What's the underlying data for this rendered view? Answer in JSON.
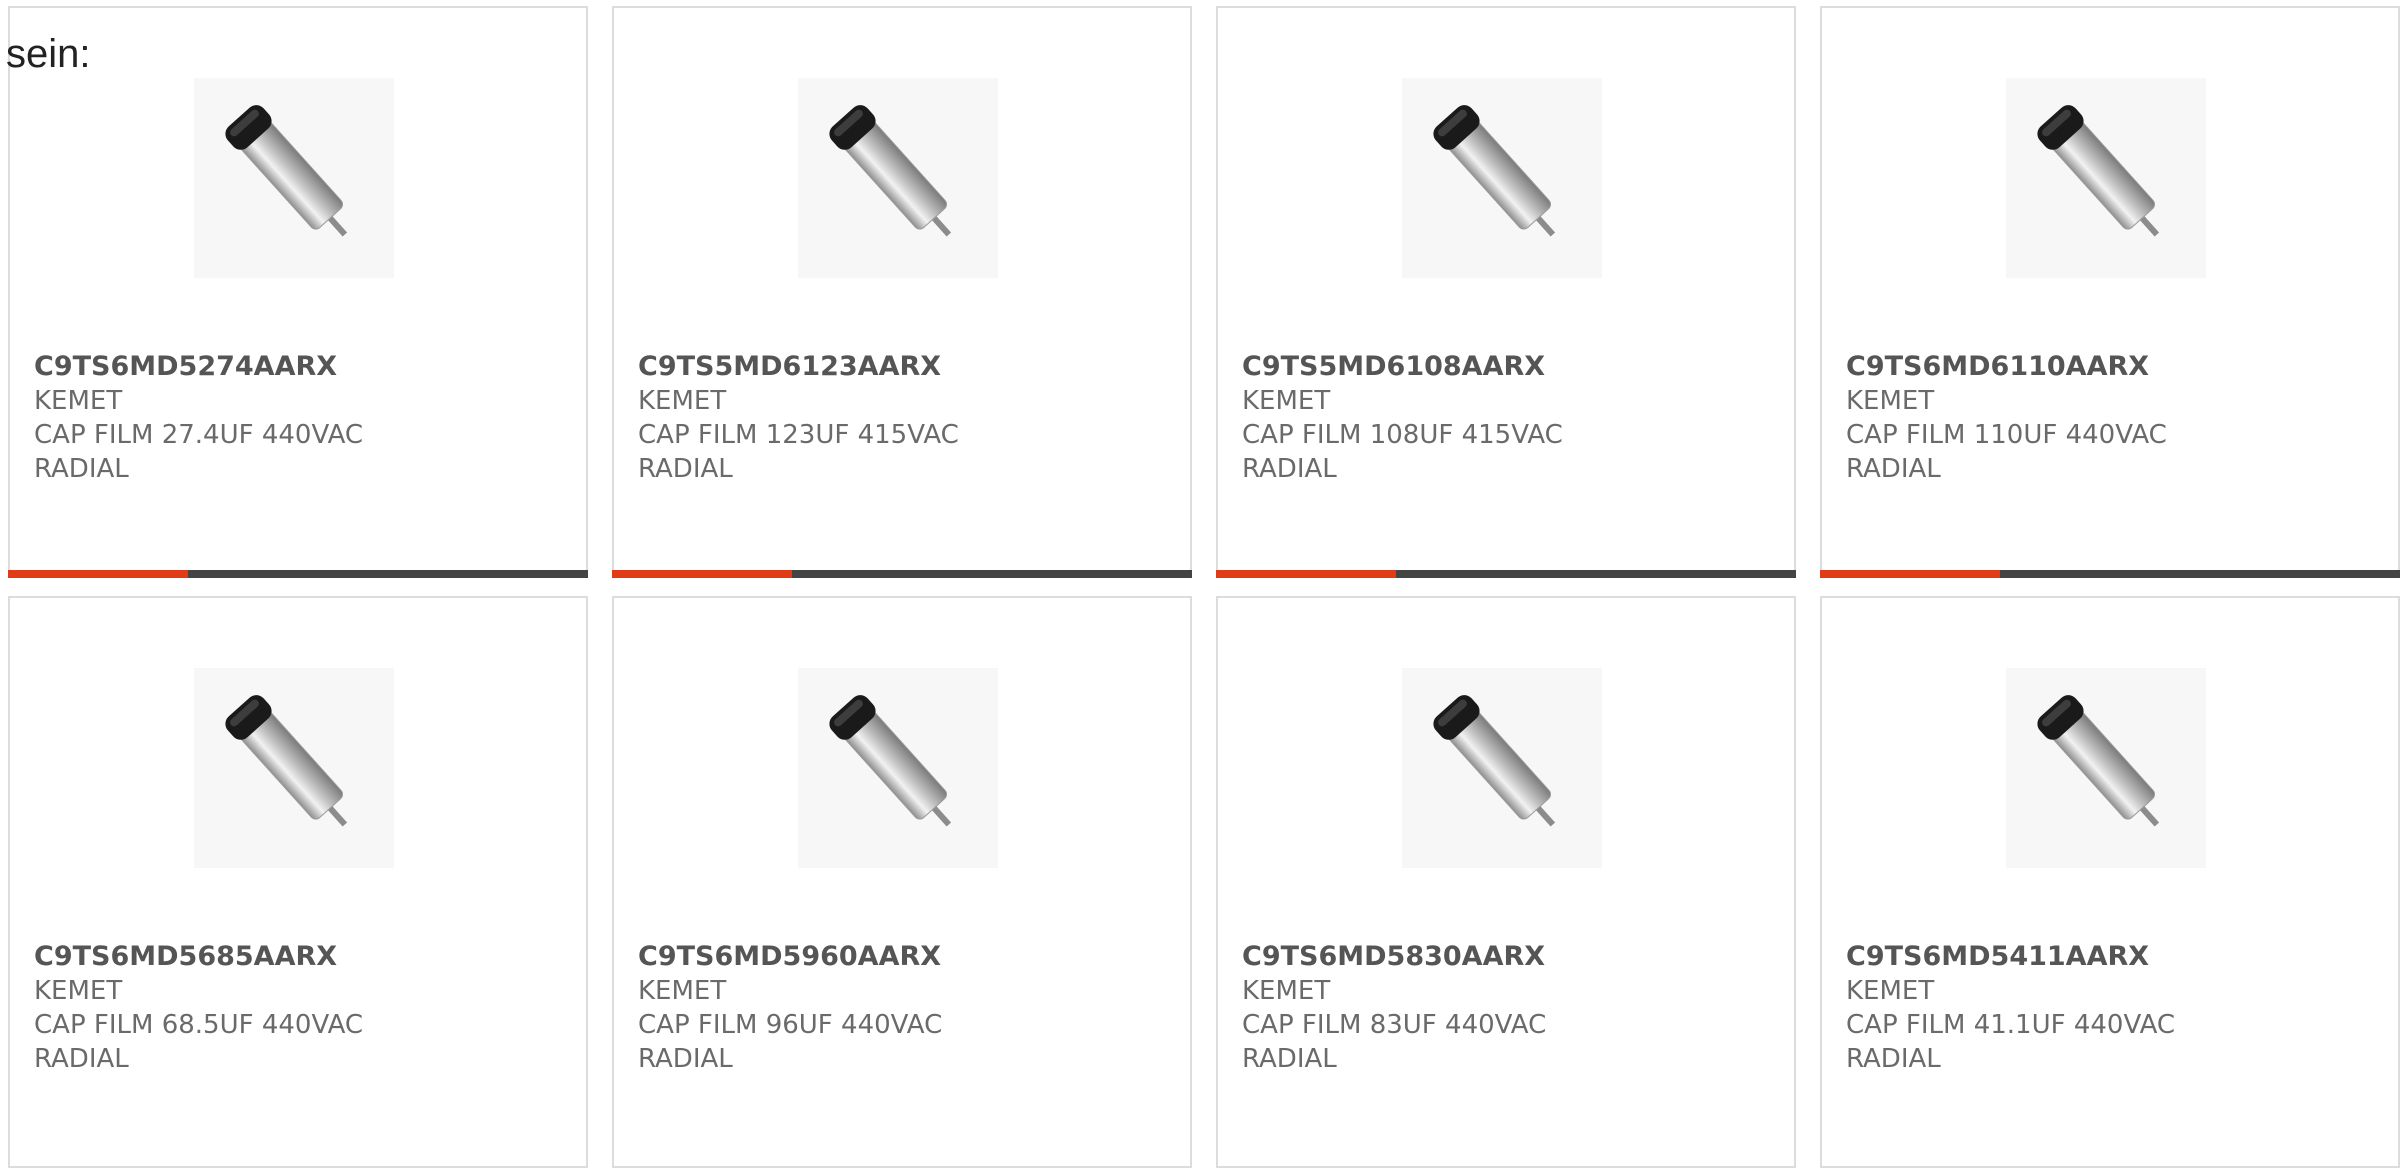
{
  "intro_text": "sein:",
  "colors": {
    "accent": "#e03c16",
    "bar_track": "#444444",
    "border": "#dcdcdc"
  },
  "products": [
    {
      "part": "C9TS6MD5274AARX",
      "maker": "KEMET",
      "desc": "CAP FILM 27.4UF 440VAC RADIAL",
      "image_icon": "film-capacitor-icon",
      "bar_fill": 0.31
    },
    {
      "part": "C9TS5MD6123AARX",
      "maker": "KEMET",
      "desc": "CAP FILM 123UF 415VAC RADIAL",
      "image_icon": "film-capacitor-icon",
      "bar_fill": 0.31
    },
    {
      "part": "C9TS5MD6108AARX",
      "maker": "KEMET",
      "desc": "CAP FILM 108UF 415VAC RADIAL",
      "image_icon": "film-capacitor-icon",
      "bar_fill": 0.31
    },
    {
      "part": "C9TS6MD6110AARX",
      "maker": "KEMET",
      "desc": "CAP FILM 110UF 440VAC RADIAL",
      "image_icon": "film-capacitor-icon",
      "bar_fill": 0.31
    },
    {
      "part": "C9TS6MD5685AARX",
      "maker": "KEMET",
      "desc": "CAP FILM 68.5UF 440VAC RADIAL",
      "image_icon": "film-capacitor-icon"
    },
    {
      "part": "C9TS6MD5960AARX",
      "maker": "KEMET",
      "desc": "CAP FILM 96UF 440VAC RADIAL",
      "image_icon": "film-capacitor-icon"
    },
    {
      "part": "C9TS6MD5830AARX",
      "maker": "KEMET",
      "desc": "CAP FILM 83UF 440VAC RADIAL",
      "image_icon": "film-capacitor-icon"
    },
    {
      "part": "C9TS6MD5411AARX",
      "maker": "KEMET",
      "desc": "CAP FILM 41.1UF 440VAC RADIAL",
      "image_icon": "film-capacitor-icon"
    }
  ]
}
